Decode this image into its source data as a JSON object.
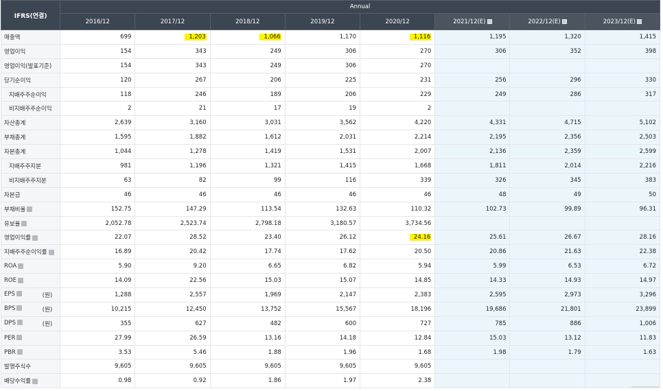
{
  "header": {
    "corner_label": "IFRS(연결)",
    "group_label": "Annual",
    "years": [
      {
        "label": "2016/12",
        "estimate": false
      },
      {
        "label": "2017/12",
        "estimate": false
      },
      {
        "label": "2018/12",
        "estimate": false
      },
      {
        "label": "2019/12",
        "estimate": false
      },
      {
        "label": "2020/12",
        "estimate": false
      },
      {
        "label": "2021/12(E)",
        "estimate": true
      },
      {
        "label": "2022/12(E)",
        "estimate": true
      },
      {
        "label": "2023/12(E)",
        "estimate": true
      }
    ]
  },
  "rows": [
    {
      "label": "매출액",
      "sub": false,
      "info": false,
      "unit": "",
      "values": [
        "699",
        "1,203",
        "1,066",
        "1,170",
        "1,116",
        "1,195",
        "1,320",
        "1,415"
      ],
      "highlight": [
        1,
        2,
        4
      ]
    },
    {
      "label": "영업이익",
      "sub": false,
      "info": false,
      "unit": "",
      "values": [
        "154",
        "343",
        "249",
        "306",
        "270",
        "306",
        "352",
        "398"
      ],
      "highlight": []
    },
    {
      "label": "영업이익(발표기준)",
      "sub": false,
      "info": false,
      "unit": "",
      "values": [
        "154",
        "343",
        "249",
        "306",
        "270",
        "",
        "",
        ""
      ],
      "highlight": []
    },
    {
      "label": "당기순이익",
      "sub": false,
      "info": false,
      "unit": "",
      "values": [
        "120",
        "267",
        "206",
        "225",
        "231",
        "256",
        "296",
        "330"
      ],
      "highlight": []
    },
    {
      "label": "지배주주순이익",
      "sub": true,
      "info": false,
      "unit": "",
      "values": [
        "118",
        "246",
        "189",
        "206",
        "229",
        "249",
        "286",
        "317"
      ],
      "highlight": []
    },
    {
      "label": "비지배주주순이익",
      "sub": true,
      "info": false,
      "unit": "",
      "values": [
        "2",
        "21",
        "17",
        "19",
        "2",
        "",
        "",
        ""
      ],
      "highlight": []
    },
    {
      "label": "자산총계",
      "sub": false,
      "info": false,
      "unit": "",
      "values": [
        "2,639",
        "3,160",
        "3,031",
        "3,562",
        "4,220",
        "4,331",
        "4,715",
        "5,102"
      ],
      "highlight": []
    },
    {
      "label": "부채총계",
      "sub": false,
      "info": false,
      "unit": "",
      "values": [
        "1,595",
        "1,882",
        "1,612",
        "2,031",
        "2,214",
        "2,195",
        "2,356",
        "2,503"
      ],
      "highlight": []
    },
    {
      "label": "자본총계",
      "sub": false,
      "info": false,
      "unit": "",
      "values": [
        "1,044",
        "1,278",
        "1,419",
        "1,531",
        "2,007",
        "2,136",
        "2,359",
        "2,599"
      ],
      "highlight": []
    },
    {
      "label": "지배주주지분",
      "sub": true,
      "info": false,
      "unit": "",
      "values": [
        "981",
        "1,196",
        "1,321",
        "1,415",
        "1,668",
        "1,811",
        "2,014",
        "2,216"
      ],
      "highlight": []
    },
    {
      "label": "비지배주주지분",
      "sub": true,
      "info": false,
      "unit": "",
      "values": [
        "63",
        "82",
        "99",
        "116",
        "339",
        "326",
        "345",
        "383"
      ],
      "highlight": []
    },
    {
      "label": "자본금",
      "sub": false,
      "info": false,
      "unit": "",
      "values": [
        "46",
        "46",
        "46",
        "46",
        "46",
        "48",
        "49",
        "50"
      ],
      "highlight": []
    },
    {
      "label": "부채비율",
      "sub": false,
      "info": true,
      "unit": "",
      "values": [
        "152.75",
        "147.29",
        "113.54",
        "132.63",
        "110.32",
        "102.73",
        "99.89",
        "96.31"
      ],
      "highlight": []
    },
    {
      "label": "유보율",
      "sub": false,
      "info": true,
      "unit": "",
      "values": [
        "2,052.78",
        "2,523.74",
        "2,798.18",
        "3,180.57",
        "3,734.56",
        "",
        "",
        ""
      ],
      "highlight": []
    },
    {
      "label": "영업이익률",
      "sub": false,
      "info": true,
      "unit": "",
      "values": [
        "22.07",
        "28.52",
        "23.40",
        "26.12",
        "24.16",
        "25.61",
        "26.67",
        "28.16"
      ],
      "highlight": [
        4
      ]
    },
    {
      "label": "지배주주순이익률",
      "sub": false,
      "info": true,
      "unit": "",
      "values": [
        "16.89",
        "20.42",
        "17.74",
        "17.62",
        "20.50",
        "20.86",
        "21.63",
        "22.38"
      ],
      "highlight": []
    },
    {
      "label": "ROA",
      "sub": false,
      "info": true,
      "unit": "",
      "values": [
        "5.90",
        "9.20",
        "6.65",
        "6.82",
        "5.94",
        "5.99",
        "6.53",
        "6.72"
      ],
      "highlight": []
    },
    {
      "label": "ROE",
      "sub": false,
      "info": true,
      "unit": "",
      "values": [
        "14.09",
        "22.56",
        "15.03",
        "15.07",
        "14.85",
        "14.33",
        "14.93",
        "14.97"
      ],
      "highlight": []
    },
    {
      "label": "EPS",
      "sub": false,
      "info": true,
      "unit": "(원)",
      "values": [
        "1,288",
        "2,557",
        "1,969",
        "2,147",
        "2,383",
        "2,595",
        "2,973",
        "3,296"
      ],
      "highlight": []
    },
    {
      "label": "BPS",
      "sub": false,
      "info": true,
      "unit": "(원)",
      "values": [
        "10,215",
        "12,450",
        "13,752",
        "15,567",
        "18,196",
        "19,686",
        "21,801",
        "23,899"
      ],
      "highlight": []
    },
    {
      "label": "DPS",
      "sub": false,
      "info": true,
      "unit": "(원)",
      "values": [
        "355",
        "627",
        "482",
        "600",
        "727",
        "785",
        "886",
        "1,006"
      ],
      "highlight": []
    },
    {
      "label": "PER",
      "sub": false,
      "info": true,
      "unit": "",
      "values": [
        "27.99",
        "26.59",
        "13.16",
        "14.18",
        "12.84",
        "15.03",
        "13.12",
        "11.83"
      ],
      "highlight": []
    },
    {
      "label": "PBR",
      "sub": false,
      "info": true,
      "unit": "",
      "values": [
        "3.53",
        "5.46",
        "1.88",
        "1.96",
        "1.68",
        "1.98",
        "1.79",
        "1.63"
      ],
      "highlight": []
    },
    {
      "label": "발행주식수",
      "sub": false,
      "info": false,
      "unit": "",
      "values": [
        "9,605",
        "9,605",
        "9,605",
        "9,605",
        "9,605",
        "",
        "",
        ""
      ],
      "highlight": []
    },
    {
      "label": "배당수익률",
      "sub": false,
      "info": true,
      "unit": "",
      "values": [
        "0.98",
        "0.92",
        "1.86",
        "1.97",
        "2.38",
        "",
        "",
        ""
      ],
      "highlight": []
    }
  ],
  "colors": {
    "header_bg": "#3c4652",
    "estimate_bg": "#ebf6fb",
    "highlight": "#fff200"
  },
  "icons": {
    "memo": "memo-icon",
    "info": "info-icon"
  }
}
